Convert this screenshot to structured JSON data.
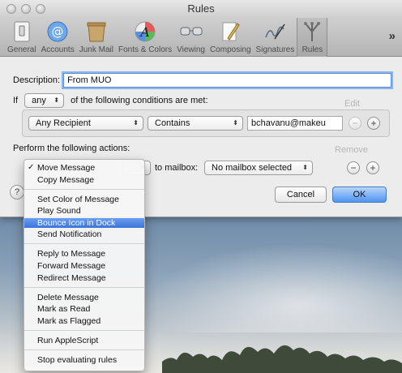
{
  "window": {
    "title": "Rules"
  },
  "toolbar": {
    "items": [
      {
        "label": "General",
        "icon": "switch-icon"
      },
      {
        "label": "Accounts",
        "icon": "at-icon"
      },
      {
        "label": "Junk Mail",
        "icon": "trash-bin-icon"
      },
      {
        "label": "Fonts & Colors",
        "icon": "font-palette-icon"
      },
      {
        "label": "Viewing",
        "icon": "glasses-icon"
      },
      {
        "label": "Composing",
        "icon": "pencil-icon"
      },
      {
        "label": "Signatures",
        "icon": "signature-icon"
      },
      {
        "label": "Rules",
        "icon": "rules-icon"
      }
    ],
    "more_label": "»"
  },
  "form": {
    "description_label": "Description:",
    "description_value": "From MUO",
    "if_label": "If",
    "if_match": "any",
    "conditions_label": "of the following conditions are met:",
    "condition": {
      "field": "Any Recipient",
      "operator": "Contains",
      "value": "bchavanu@makeu"
    },
    "actions_label": "Perform the following actions:",
    "to_mailbox_label": "to mailbox:",
    "mailbox_value": "No mailbox selected",
    "cancel_label": "Cancel",
    "ok_label": "OK",
    "help_label": "?",
    "minus_label": "−",
    "plus_label": "+"
  },
  "background_buttons": {
    "edit": "Edit",
    "remove": "Remove"
  },
  "menu": {
    "groups": [
      [
        {
          "label": "Move Message",
          "checked": true
        },
        {
          "label": "Copy Message"
        }
      ],
      [
        {
          "label": "Set Color of Message"
        },
        {
          "label": "Play Sound"
        },
        {
          "label": "Bounce Icon in Dock",
          "highlighted": true
        },
        {
          "label": "Send Notification"
        }
      ],
      [
        {
          "label": "Reply to Message"
        },
        {
          "label": "Forward Message"
        },
        {
          "label": "Redirect Message"
        }
      ],
      [
        {
          "label": "Delete Message"
        },
        {
          "label": "Mark as Read"
        },
        {
          "label": "Mark as Flagged"
        }
      ],
      [
        {
          "label": "Run AppleScript"
        }
      ],
      [
        {
          "label": "Stop evaluating rules"
        }
      ]
    ],
    "check_mark": "✓"
  },
  "colors": {
    "accent": "#3d73da",
    "focus_ring": "#8db5ea"
  }
}
